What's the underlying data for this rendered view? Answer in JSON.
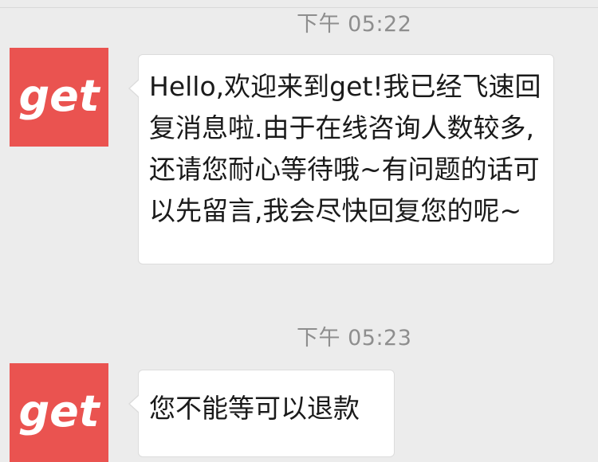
{
  "chat": {
    "messages": [
      {
        "time": "下午 05:22",
        "sender_avatar_text": "get",
        "text": "Hello,欢迎来到get!我已经飞速回复消息啦.由于在线咨询人数较多,还请您耐心等待哦~有问题的话可以先留言,我会尽快回复您的呢~"
      },
      {
        "time": "下午 05:23",
        "sender_avatar_text": "get",
        "text": "您不能等可以退款"
      }
    ]
  },
  "colors": {
    "background": "#ececec",
    "avatar": "#ea5350",
    "bubble": "#ffffff",
    "timestamp": "#8e8e8e"
  },
  "icons": {
    "avatar_logo": "get-logo-icon"
  }
}
